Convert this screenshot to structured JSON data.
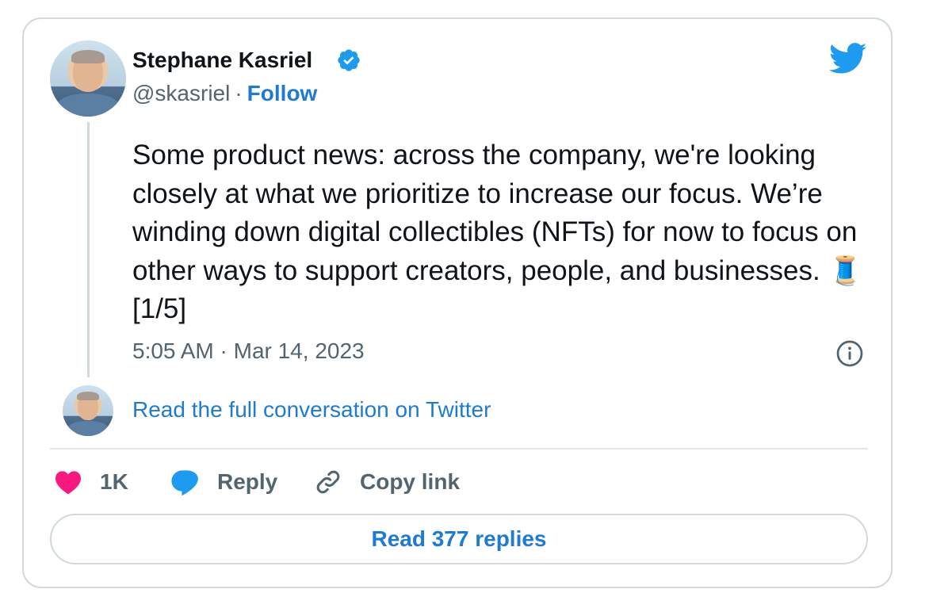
{
  "author": {
    "name": "Stephane Kasriel",
    "handle": "@skasriel",
    "separator": "·",
    "follow_label": "Follow"
  },
  "tweet": {
    "text": "Some product news: across the company, we're looking closely at what we prioritize to increase our focus. We’re winding down digital collectibles (NFTs) for now to focus on other ways to support creators, people, and businesses. 🧵[1/5]",
    "timestamp": "5:05 AM · Mar 14, 2023"
  },
  "thread": {
    "read_full_label": "Read the full conversation on Twitter"
  },
  "actions": {
    "like_count": "1K",
    "reply_label": "Reply",
    "copy_link_label": "Copy link"
  },
  "replies": {
    "read_label": "Read 377 replies"
  },
  "colors": {
    "accent": "#1d7bd4",
    "twitter_blue": "#1d9bf0",
    "like_pink": "#f91880",
    "muted": "#536471",
    "border": "#cfd9de"
  },
  "icons": {
    "verified": "verified-badge-icon",
    "logo": "twitter-bird-icon",
    "info": "info-icon",
    "like": "heart-icon",
    "reply": "speech-bubble-icon",
    "copy": "link-icon",
    "thread_emoji": "spool-of-thread-emoji"
  }
}
